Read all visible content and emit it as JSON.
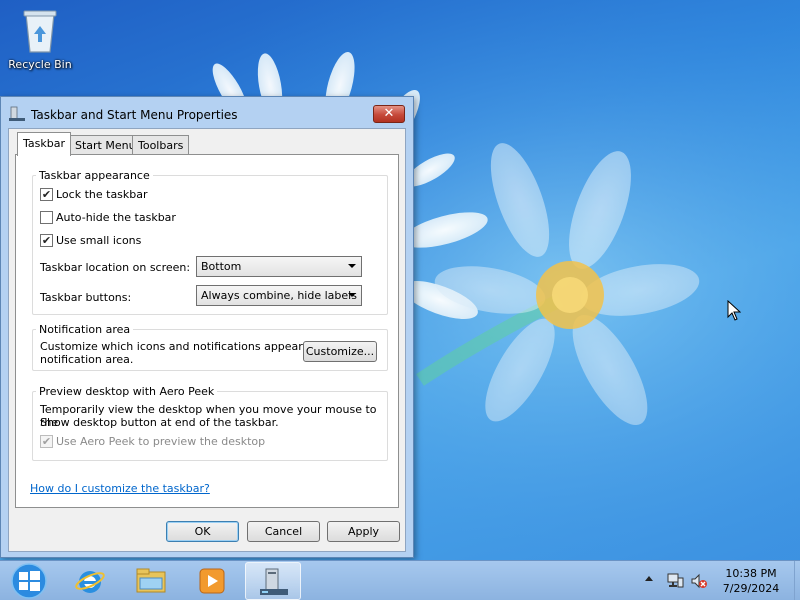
{
  "desktop": {
    "icons": [
      {
        "label": "Recycle Bin",
        "icon": "recycle-bin-icon"
      }
    ]
  },
  "window": {
    "title": "Taskbar and Start Menu Properties",
    "close_label": "✕",
    "tabs": [
      {
        "label": "Taskbar",
        "active": true
      },
      {
        "label": "Start Menu",
        "active": false
      },
      {
        "label": "Toolbars",
        "active": false
      }
    ],
    "appearance": {
      "title": "Taskbar appearance",
      "lock_label": "Lock the taskbar",
      "lock_checked": true,
      "autohide_label": "Auto-hide the taskbar",
      "autohide_checked": false,
      "small_icons_label": "Use small icons",
      "small_icons_checked": true,
      "location_label": "Taskbar location on screen:",
      "location_value": "Bottom",
      "buttons_label": "Taskbar buttons:",
      "buttons_value": "Always combine, hide labels"
    },
    "notification": {
      "title": "Notification area",
      "desc_line1": "Customize which icons and notifications appear in the",
      "desc_line2": "notification area.",
      "customize_label": "Customize..."
    },
    "peek": {
      "title": "Preview desktop with Aero Peek",
      "desc_line1": "Temporarily view the desktop when you move your mouse to the",
      "desc_line2": "Show desktop button at end of the taskbar.",
      "checkbox_label": "Use Aero Peek to preview the desktop",
      "checkbox_checked": true,
      "checkbox_disabled": true
    },
    "help_link": "How do I customize the taskbar?",
    "ok_label": "OK",
    "cancel_label": "Cancel",
    "apply_label": "Apply"
  },
  "taskbar": {
    "pinned": [
      {
        "icon": "internet-explorer-icon"
      },
      {
        "icon": "file-explorer-icon"
      },
      {
        "icon": "media-player-icon"
      },
      {
        "icon": "taskbar-properties-icon",
        "active": true
      }
    ],
    "tray_icons": [
      "network-icon",
      "volume-muted-icon"
    ],
    "time": "10:38 PM",
    "date": "7/29/2024"
  },
  "colors": {
    "desktop_blue": "#2f86dd",
    "link": "#0066cc",
    "close_red": "#c6493a"
  }
}
